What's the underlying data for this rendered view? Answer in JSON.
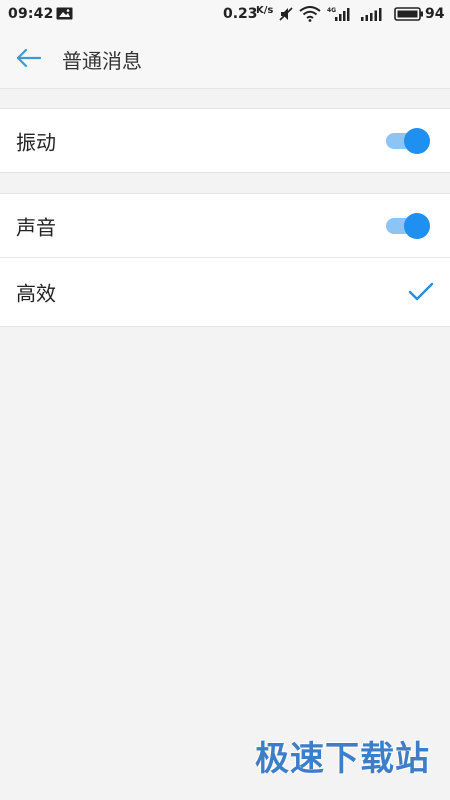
{
  "status_bar": {
    "time": "09:42",
    "net_speed": "0.23",
    "net_speed_unit": "K/s",
    "network_type": "4G",
    "battery_level": "94"
  },
  "header": {
    "title": "普通消息"
  },
  "groups": [
    {
      "rows": [
        {
          "label": "振动",
          "control": "toggle",
          "on": true
        }
      ]
    },
    {
      "rows": [
        {
          "label": "声音",
          "control": "toggle",
          "on": true
        },
        {
          "label": "高效",
          "control": "checkmark",
          "checked": true
        }
      ]
    }
  ],
  "watermark": "极速下载站",
  "colors": {
    "accent": "#1f8ff0",
    "toggle_track": "#8cc4f5",
    "back_arrow": "#3a9ad9",
    "background": "#f3f3f3"
  }
}
